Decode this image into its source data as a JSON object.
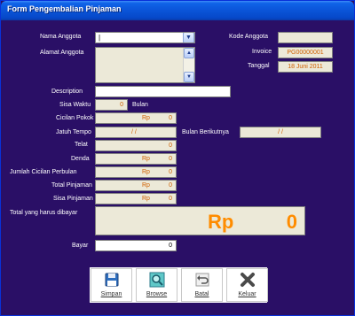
{
  "window": {
    "title": "Form Pengembalian Pinjaman"
  },
  "labels": {
    "nama_anggota": "Nama Anggota",
    "alamat_anggota": "Alamat Anggota",
    "kode_anggota": "Kode Anggota",
    "invoice": "Invoice",
    "tanggal": "Tanggal",
    "description": "Description",
    "sisa_waktu": "Sisa Waktu",
    "bulan_unit": "Bulan",
    "cicilan_pokok": "Cicilan Pokok",
    "jatuh_tempo": "Jatuh Tempo",
    "bulan_berikutnya": "Bulan Berikutnya",
    "telat": "Telat",
    "denda": "Denda",
    "jumlah_cicilan_perbulan": "Jumlah Cicilan Perbulan",
    "total_pinjaman": "Total Pinjaman",
    "sisa_pinjaman": "Sisa Pinjaman",
    "total_harus_dibayar": "Total yang harus dibayar",
    "bayar": "Bayar"
  },
  "values": {
    "nama_anggota": "",
    "kode_anggota": "",
    "invoice": "PG00000001",
    "tanggal": "18 Juni 2011",
    "description": "",
    "sisa_waktu": "0",
    "currency": "Rp",
    "cicilan_pokok": "0",
    "jatuh_tempo": "/ /",
    "bulan_berikutnya": "/ /",
    "telat": "0",
    "denda": "0",
    "jumlah_cicilan_perbulan": "0",
    "total_pinjaman": "0",
    "sisa_pinjaman": "0",
    "total_harus_dibayar": "0",
    "bayar": "0"
  },
  "buttons": {
    "simpan": "Simpan",
    "browse": "Browse",
    "batal": "Batal",
    "keluar": "Keluar"
  },
  "icons": {
    "dropdown": "chevron-down-icon",
    "scroll_up": "arrow-up-icon",
    "scroll_down": "arrow-down-icon"
  }
}
